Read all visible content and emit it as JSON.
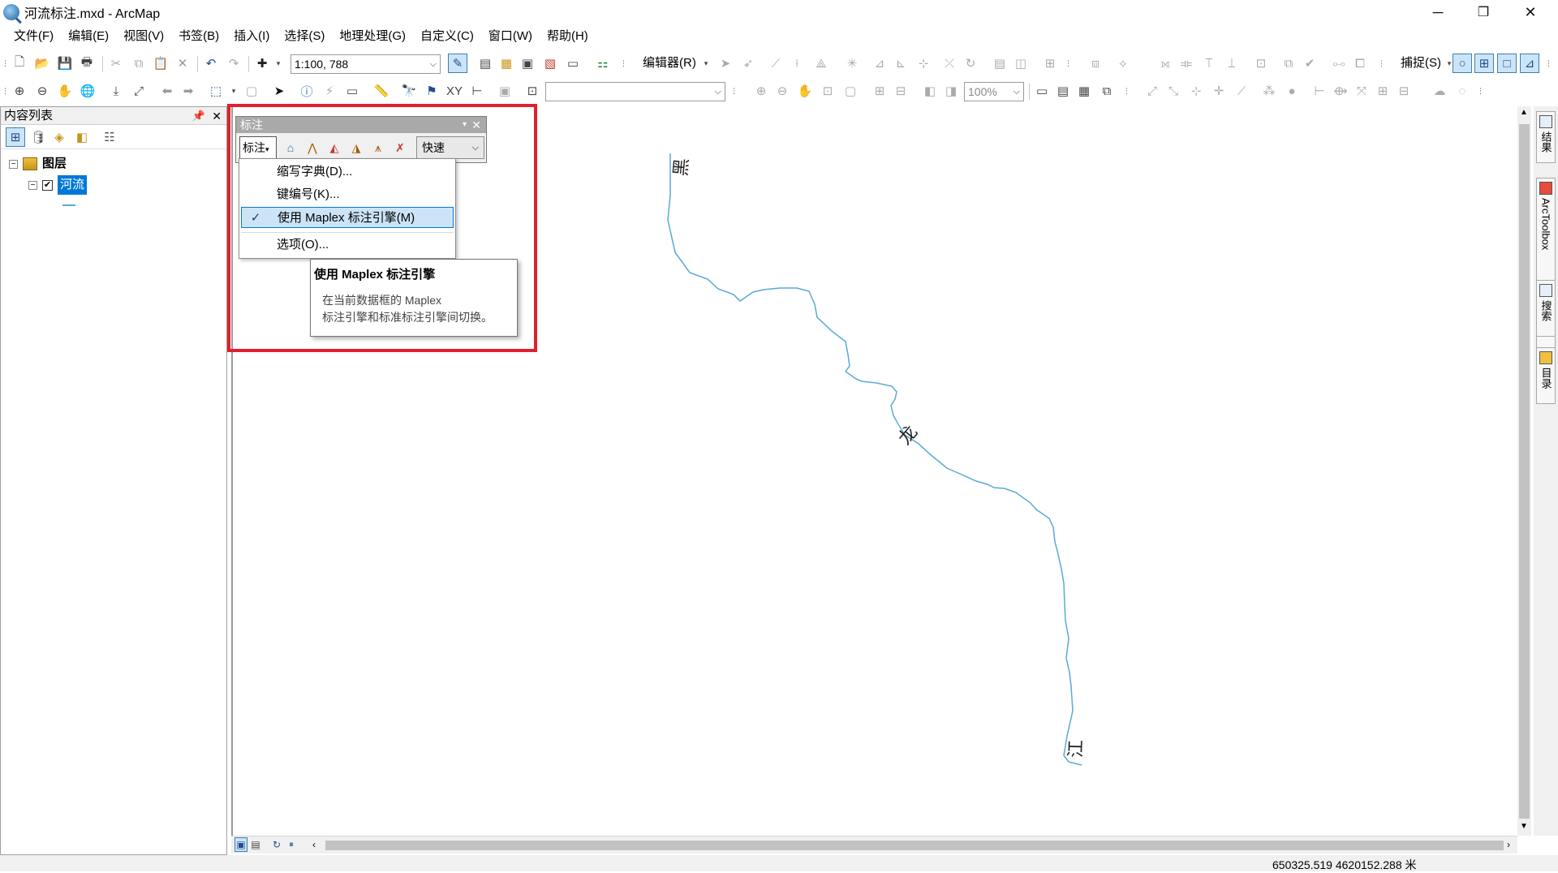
{
  "window": {
    "title": "河流标注.mxd - ArcMap",
    "minimize": "─",
    "restore": "❐",
    "close": "✕"
  },
  "menu": [
    "文件(F)",
    "编辑(E)",
    "视图(V)",
    "书签(B)",
    "插入(I)",
    "选择(S)",
    "地理处理(G)",
    "自定义(C)",
    "窗口(W)",
    "帮助(H)"
  ],
  "toolbar": {
    "scale": "1:100, 788",
    "editor_label": "编辑器(R)",
    "snapping_label": "捕捉(S)",
    "layout_zoom": "100%",
    "target_combo": ""
  },
  "toc": {
    "title": "内容列表",
    "pin": "ᵖ",
    "close": "✕",
    "group_name": "图层",
    "layer_name": "河流",
    "layer_checked": "✔"
  },
  "labeling_toolbar": {
    "title": "标注",
    "labeling_menu": "标注",
    "quality": "快速"
  },
  "dropdown": {
    "items": [
      {
        "label": "缩写字典(D)...",
        "checked": false
      },
      {
        "label": "键编号(K)...",
        "checked": false
      },
      {
        "label": "使用 Maplex 标注引擎(M)",
        "checked": true
      },
      {
        "label": "选项(O)...",
        "checked": false
      }
    ],
    "checkmark": "✓"
  },
  "tooltip": {
    "title": "使用 Maplex 标注引擎",
    "body_line1": "在当前数据框的 Maplex",
    "body_line2": "标注引擎和标准标注引擎间切换。"
  },
  "map": {
    "labels": [
      "黑",
      "龙",
      "江"
    ],
    "river_color": "#5aa9d6"
  },
  "right_dock": [
    "结果",
    "ArcToolbox",
    "搜索",
    "目录"
  ],
  "status": {
    "coordinates": "650325.519  4620152.288 米"
  },
  "colors": {
    "highlight": "#e0202e",
    "selection": "#0078d7"
  }
}
